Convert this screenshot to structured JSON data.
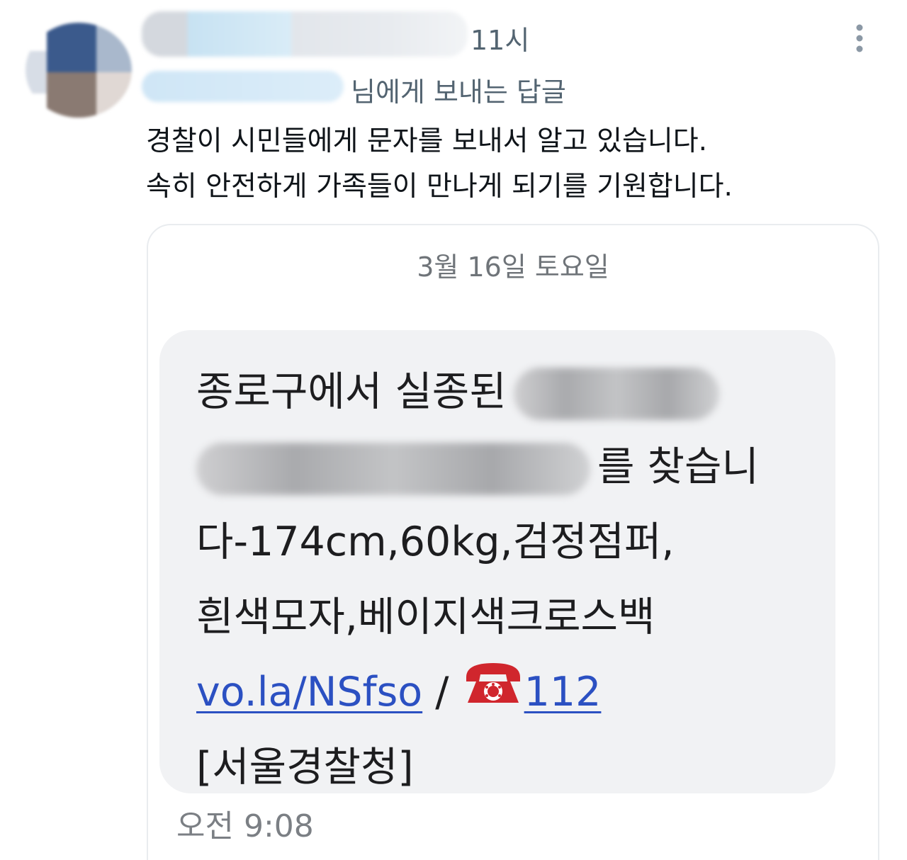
{
  "reply": {
    "time": "11시",
    "replying_to": "님에게 보내는 답글",
    "text_lines": [
      "경찰이 시민들에게 문자를 보내서 알고 있습니다.",
      "속히 안전하게 가족들이 만나게 되기를 기원합니다."
    ],
    "more_icon": "more-vertical-icon"
  },
  "sms": {
    "date_header": "3월 16일 토요일",
    "line1_prefix": "종로구에서 실종된",
    "line2_suffix": "를 찾습니",
    "line3": "다-174cm,60kg,검정점퍼,",
    "line4": "흰색모자,베이지색크로스백",
    "link": "vo.la/NSfso",
    "separator": " / ",
    "phone_icon": "telephone-icon",
    "phone_number": "112",
    "sender": "[서울경찰청]",
    "time": "오전 9:08"
  },
  "colors": {
    "secondary_text": "#536471",
    "link": "#2b50c2",
    "bubble": "#f1f2f4",
    "phone_icon": "#d0262d"
  }
}
